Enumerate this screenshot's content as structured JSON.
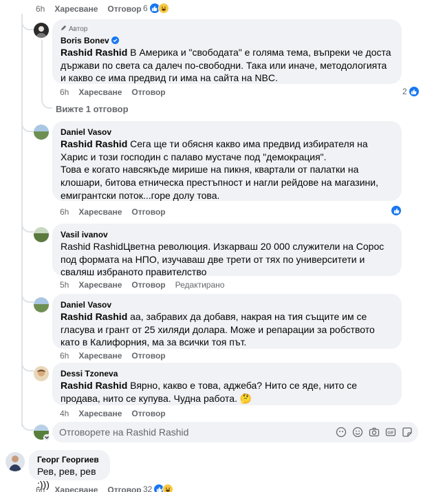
{
  "top_row": {
    "time": "6h",
    "like_label": "Харесване",
    "reply_label": "Отговор",
    "reaction_count": "6"
  },
  "boris": {
    "badge": "Автор",
    "name": "Boris Bonev",
    "mention": "Rashid Rashid",
    "text": " В Америка и \"свободата\" е голяма тема, въпреки че доста държави по света са далеч по-свободни. Така или иначе, методологията и какво се има предвид ги има на сайта на NBC.",
    "time": "6h",
    "like_label": "Харесване",
    "reply_label": "Отговор",
    "reaction_count": "2"
  },
  "view_replies": "Вижте 1 отговор",
  "daniel1": {
    "name": "Daniel Vasov",
    "mention": "Rashid Rashid",
    "text": " Сега ще ти обясня какво има предвид избирателя на Харис и този господин с палаво мустаче под \"демокрация\".",
    "text2": "Това е когато навсякъде мирише на пикня, квартали от палатки на клошари, битова етническа престъпност и нагли рейдове на магазини, емигрантски поток...горе долу това.",
    "time": "6h",
    "like_label": "Харесване",
    "reply_label": "Отговор"
  },
  "vasil": {
    "name": "Vasil ivanov",
    "text": "Rashid RashidЦветна революция. Изкарваш 20 000 служители на Сорос под формата на НПО, изучаваш две трети от тях по университети и сваляш избраното правителство",
    "time": "5h",
    "like_label": "Харесване",
    "reply_label": "Отговор",
    "edited_label": "Редактирано"
  },
  "daniel2": {
    "name": "Daniel Vasov",
    "mention": "Rashid Rashid",
    "text": " аа, забравих да добавя, накрая на тия същите им се гласува и грант от 25 хиляди долара. Може и репарации за робството като в Калифорния, ма за всички тоя път.",
    "time": "6h",
    "like_label": "Харесване",
    "reply_label": "Отговор"
  },
  "dessi": {
    "name": "Dessi Tzoneva",
    "mention": "Rashid Rashid",
    "text": " Вярно, какво е това, аджеба? Нито се яде, нито се продава, нито се купува. Чудна работа.",
    "emoji": "🤔",
    "time": "4h",
    "like_label": "Харесване",
    "reply_label": "Отговор"
  },
  "reply_box": {
    "placeholder": "Отговорете на Rashid Rashid"
  },
  "georg": {
    "name": "Георг Георгиев",
    "text": "Рев, рев, рев :)))",
    "time": "6h",
    "like_label": "Харесване",
    "reply_label": "Отговор",
    "reaction_count": "32"
  }
}
